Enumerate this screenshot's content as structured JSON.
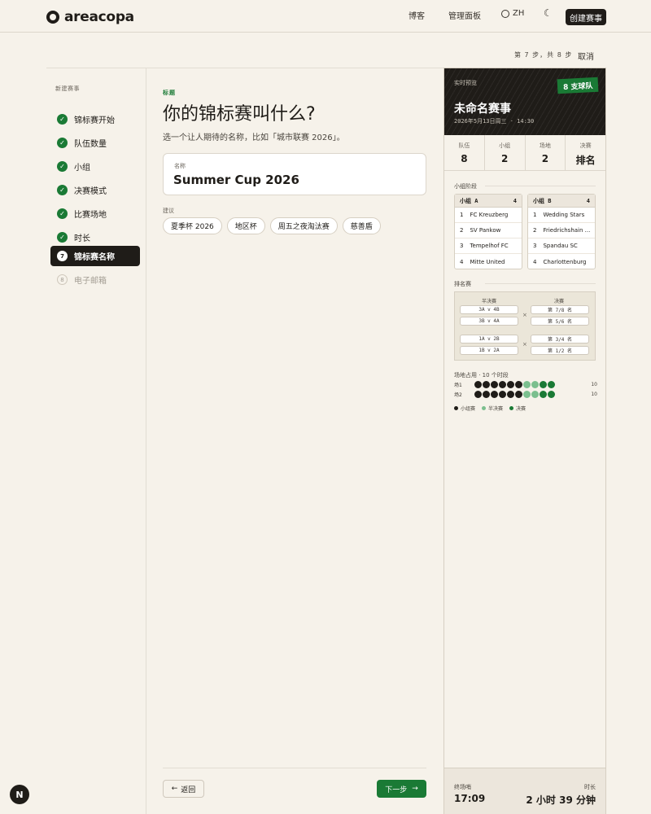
{
  "header": {
    "logo": "areacopa",
    "nav": {
      "blog": "博客",
      "admin": "管理面板",
      "lang": "ZH",
      "moon": "☾"
    },
    "create_button": "创建赛事"
  },
  "wizard": {
    "step_progress": "第 7 步，共 8 步",
    "cancel": "取消"
  },
  "sidebar": {
    "title": "新建赛事",
    "steps": [
      {
        "num": "1",
        "label": "锦标赛开始",
        "state": "done"
      },
      {
        "num": "2",
        "label": "队伍数量",
        "state": "done"
      },
      {
        "num": "3",
        "label": "小组",
        "state": "done"
      },
      {
        "num": "4",
        "label": "决赛模式",
        "state": "done"
      },
      {
        "num": "5",
        "label": "比赛场地",
        "state": "done"
      },
      {
        "num": "6",
        "label": "时长",
        "state": "done"
      },
      {
        "num": "7",
        "label": "锦标赛名称",
        "state": "active"
      },
      {
        "num": "8",
        "label": "电子邮箱",
        "state": "pending"
      }
    ]
  },
  "main": {
    "section_label": "标题",
    "title": "你的锦标赛叫什么?",
    "subtitle": "选一个让人期待的名称，比如「城市联赛 2026」。",
    "name_label": "名称",
    "name_value": "Summer Cup 2026",
    "suggestions_label": "建议",
    "suggestions": [
      "夏季杯 2026",
      "地区杯",
      "周五之夜淘汰赛",
      "慈善盾"
    ],
    "back_button": "返回",
    "next_button": "下一步"
  },
  "preview": {
    "live_label": "实时预览",
    "badge": "8 支球队",
    "title": "未命名赛事",
    "date": "2026年5月13日周三 · 14:30",
    "stats": [
      {
        "label": "队伍",
        "value": "8"
      },
      {
        "label": "小组",
        "value": "2"
      },
      {
        "label": "场地",
        "value": "2"
      },
      {
        "label": "决赛",
        "value": "排名"
      }
    ],
    "group_stage_label": "小组阶段",
    "groups": [
      {
        "name": "小组 A",
        "count": "4",
        "teams": [
          {
            "pos": "1",
            "name": "FC Kreuzberg"
          },
          {
            "pos": "2",
            "name": "SV Pankow"
          },
          {
            "pos": "3",
            "name": "Tempelhof FC"
          },
          {
            "pos": "4",
            "name": "Mitte United"
          }
        ]
      },
      {
        "name": "小组 B",
        "count": "4",
        "teams": [
          {
            "pos": "1",
            "name": "Wedding Stars"
          },
          {
            "pos": "2",
            "name": "Friedrichshain ..."
          },
          {
            "pos": "3",
            "name": "Spandau SC"
          },
          {
            "pos": "4",
            "name": "Charlottenburg"
          }
        ]
      }
    ],
    "ranking_label": "排名赛",
    "bracket": {
      "semi_label": "半决赛",
      "final_label": "决赛",
      "semis": [
        "3A v 4B",
        "3B v 4A",
        "1A v 2B",
        "1B v 2A"
      ],
      "finals": [
        "第 7/8 名",
        "第 5/6 名",
        "第 3/4 名",
        "第 1/2 名"
      ]
    },
    "occupancy_label": "场地占用 · 10 个时段",
    "pitches": [
      {
        "name": "场1",
        "count": "10",
        "slots": [
          "group",
          "group",
          "group",
          "group",
          "group",
          "group",
          "semi",
          "semi",
          "final",
          "final"
        ]
      },
      {
        "name": "场2",
        "count": "10",
        "slots": [
          "group",
          "group",
          "group",
          "group",
          "group",
          "group",
          "semi",
          "semi",
          "final",
          "final"
        ]
      }
    ],
    "legend": [
      {
        "label": "小组赛",
        "color": "#1f1c18"
      },
      {
        "label": "半决赛",
        "color": "#7bbf8e"
      },
      {
        "label": "决赛",
        "color": "#1a7a35"
      }
    ],
    "end_label": "终场哨",
    "end_value": "17:09",
    "duration_label": "时长",
    "duration_value": "2 小时 39 分钟"
  },
  "colors": {
    "accent": "#1a7a35",
    "dark": "#1f1c18",
    "bg": "#f6f2ea"
  },
  "next_badge": "N"
}
